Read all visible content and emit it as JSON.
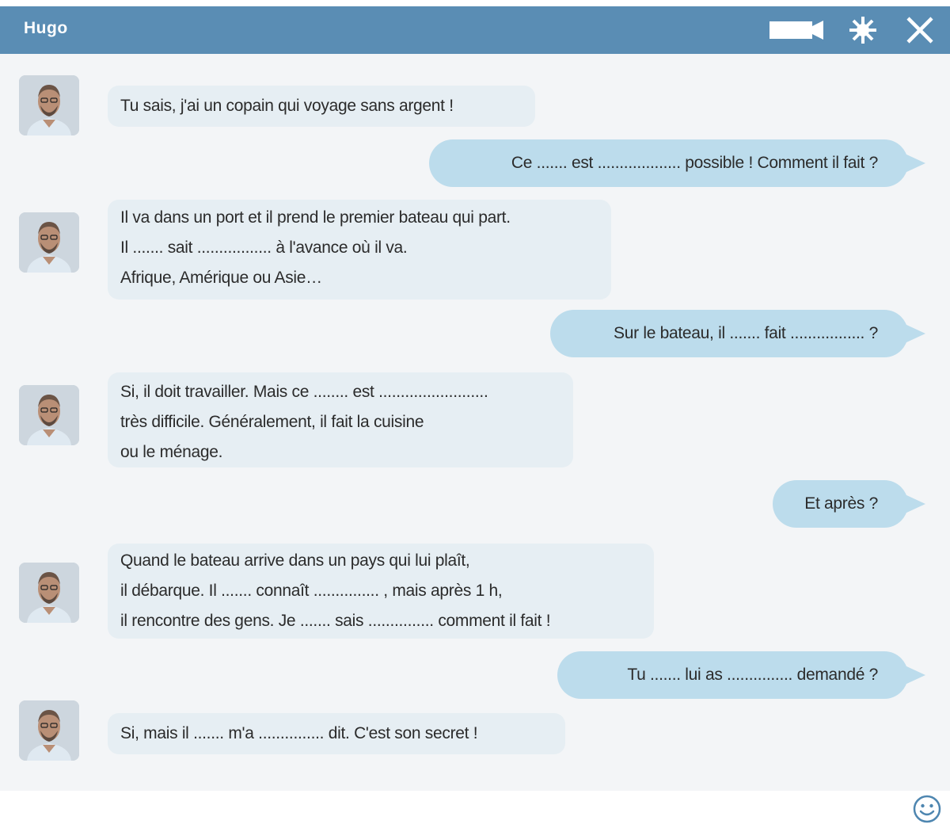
{
  "window": {
    "title": "Hugo",
    "controls": [
      "video-camera-icon",
      "settings-icon",
      "close-icon"
    ],
    "title_bar_color": "#5a8db4"
  },
  "messages": [
    {
      "sender": "Hugo",
      "direction": "in",
      "lines": [
        "Tu sais, j'ai un copain qui voyage sans argent !"
      ]
    },
    {
      "sender": "me",
      "direction": "out",
      "lines": [
        "Ce ....... est ................... possible ! Comment il fait ?"
      ]
    },
    {
      "sender": "Hugo",
      "direction": "in",
      "lines": [
        "Il va dans un port et il prend le premier bateau qui part.",
        "Il ....... sait ................. à l'avance où il va.",
        "Afrique, Amérique ou Asie…"
      ]
    },
    {
      "sender": "me",
      "direction": "out",
      "lines": [
        "Sur le bateau, il ....... fait ................. ?"
      ]
    },
    {
      "sender": "Hugo",
      "direction": "in",
      "lines": [
        "Si, il doit travailler. Mais ce ........ est .........................",
        "très difficile. Généralement, il fait la cuisine",
        "ou le ménage."
      ]
    },
    {
      "sender": "me",
      "direction": "out",
      "lines": [
        "Et après ?"
      ]
    },
    {
      "sender": "Hugo",
      "direction": "in",
      "lines": [
        "Quand le bateau arrive dans un pays qui lui plaît,",
        "il débarque. Il ....... connaît ............... , mais après 1 h,",
        "il rencontre des gens. Je ....... sais ............... comment il fait !"
      ]
    },
    {
      "sender": "me",
      "direction": "out",
      "lines": [
        "Tu ....... lui as ............... demandé ?"
      ]
    },
    {
      "sender": "Hugo",
      "direction": "in",
      "lines": [
        "Si, mais il ....... m'a ............... dit. C'est son secret !"
      ]
    }
  ],
  "colors": {
    "incoming_bubble": "#e6eef3",
    "outgoing_bubble": "#bcdcec",
    "chat_background": "#f3f5f7"
  },
  "footer": {
    "icon": "smiley-icon"
  }
}
